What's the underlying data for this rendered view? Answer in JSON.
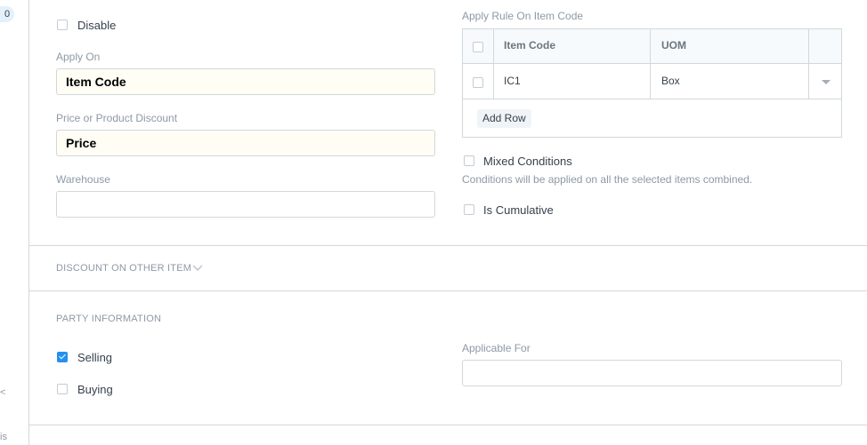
{
  "sidebar": {
    "count_badge": "0",
    "cut_text_1": "<",
    "cut_text_2": "is"
  },
  "form": {
    "disable": {
      "label": "Disable",
      "checked": false
    },
    "apply_on": {
      "label": "Apply On",
      "value": "Item Code"
    },
    "price_or_product_discount": {
      "label": "Price or Product Discount",
      "value": "Price"
    },
    "warehouse": {
      "label": "Warehouse",
      "value": ""
    },
    "apply_rule_on_item_code": {
      "label": "Apply Rule On Item Code",
      "columns": [
        "Item Code",
        "UOM"
      ],
      "rows": [
        {
          "item_code": "IC1",
          "uom": "Box"
        }
      ],
      "add_row_label": "Add Row"
    },
    "mixed_conditions": {
      "label": "Mixed Conditions",
      "checked": false,
      "help": "Conditions will be applied on all the selected items combined."
    },
    "is_cumulative": {
      "label": "Is Cumulative",
      "checked": false
    }
  },
  "sections": {
    "discount_on_other_item": "DISCOUNT ON OTHER ITEM",
    "party_information": "PARTY INFORMATION"
  },
  "party": {
    "selling": {
      "label": "Selling",
      "checked": true
    },
    "buying": {
      "label": "Buying",
      "checked": false
    },
    "applicable_for": {
      "label": "Applicable For",
      "value": ""
    }
  },
  "colors": {
    "accent": "#2490ef",
    "border": "#d1d8dd",
    "muted_text": "#8d99a6",
    "filled_input_bg": "#fffdf4"
  }
}
